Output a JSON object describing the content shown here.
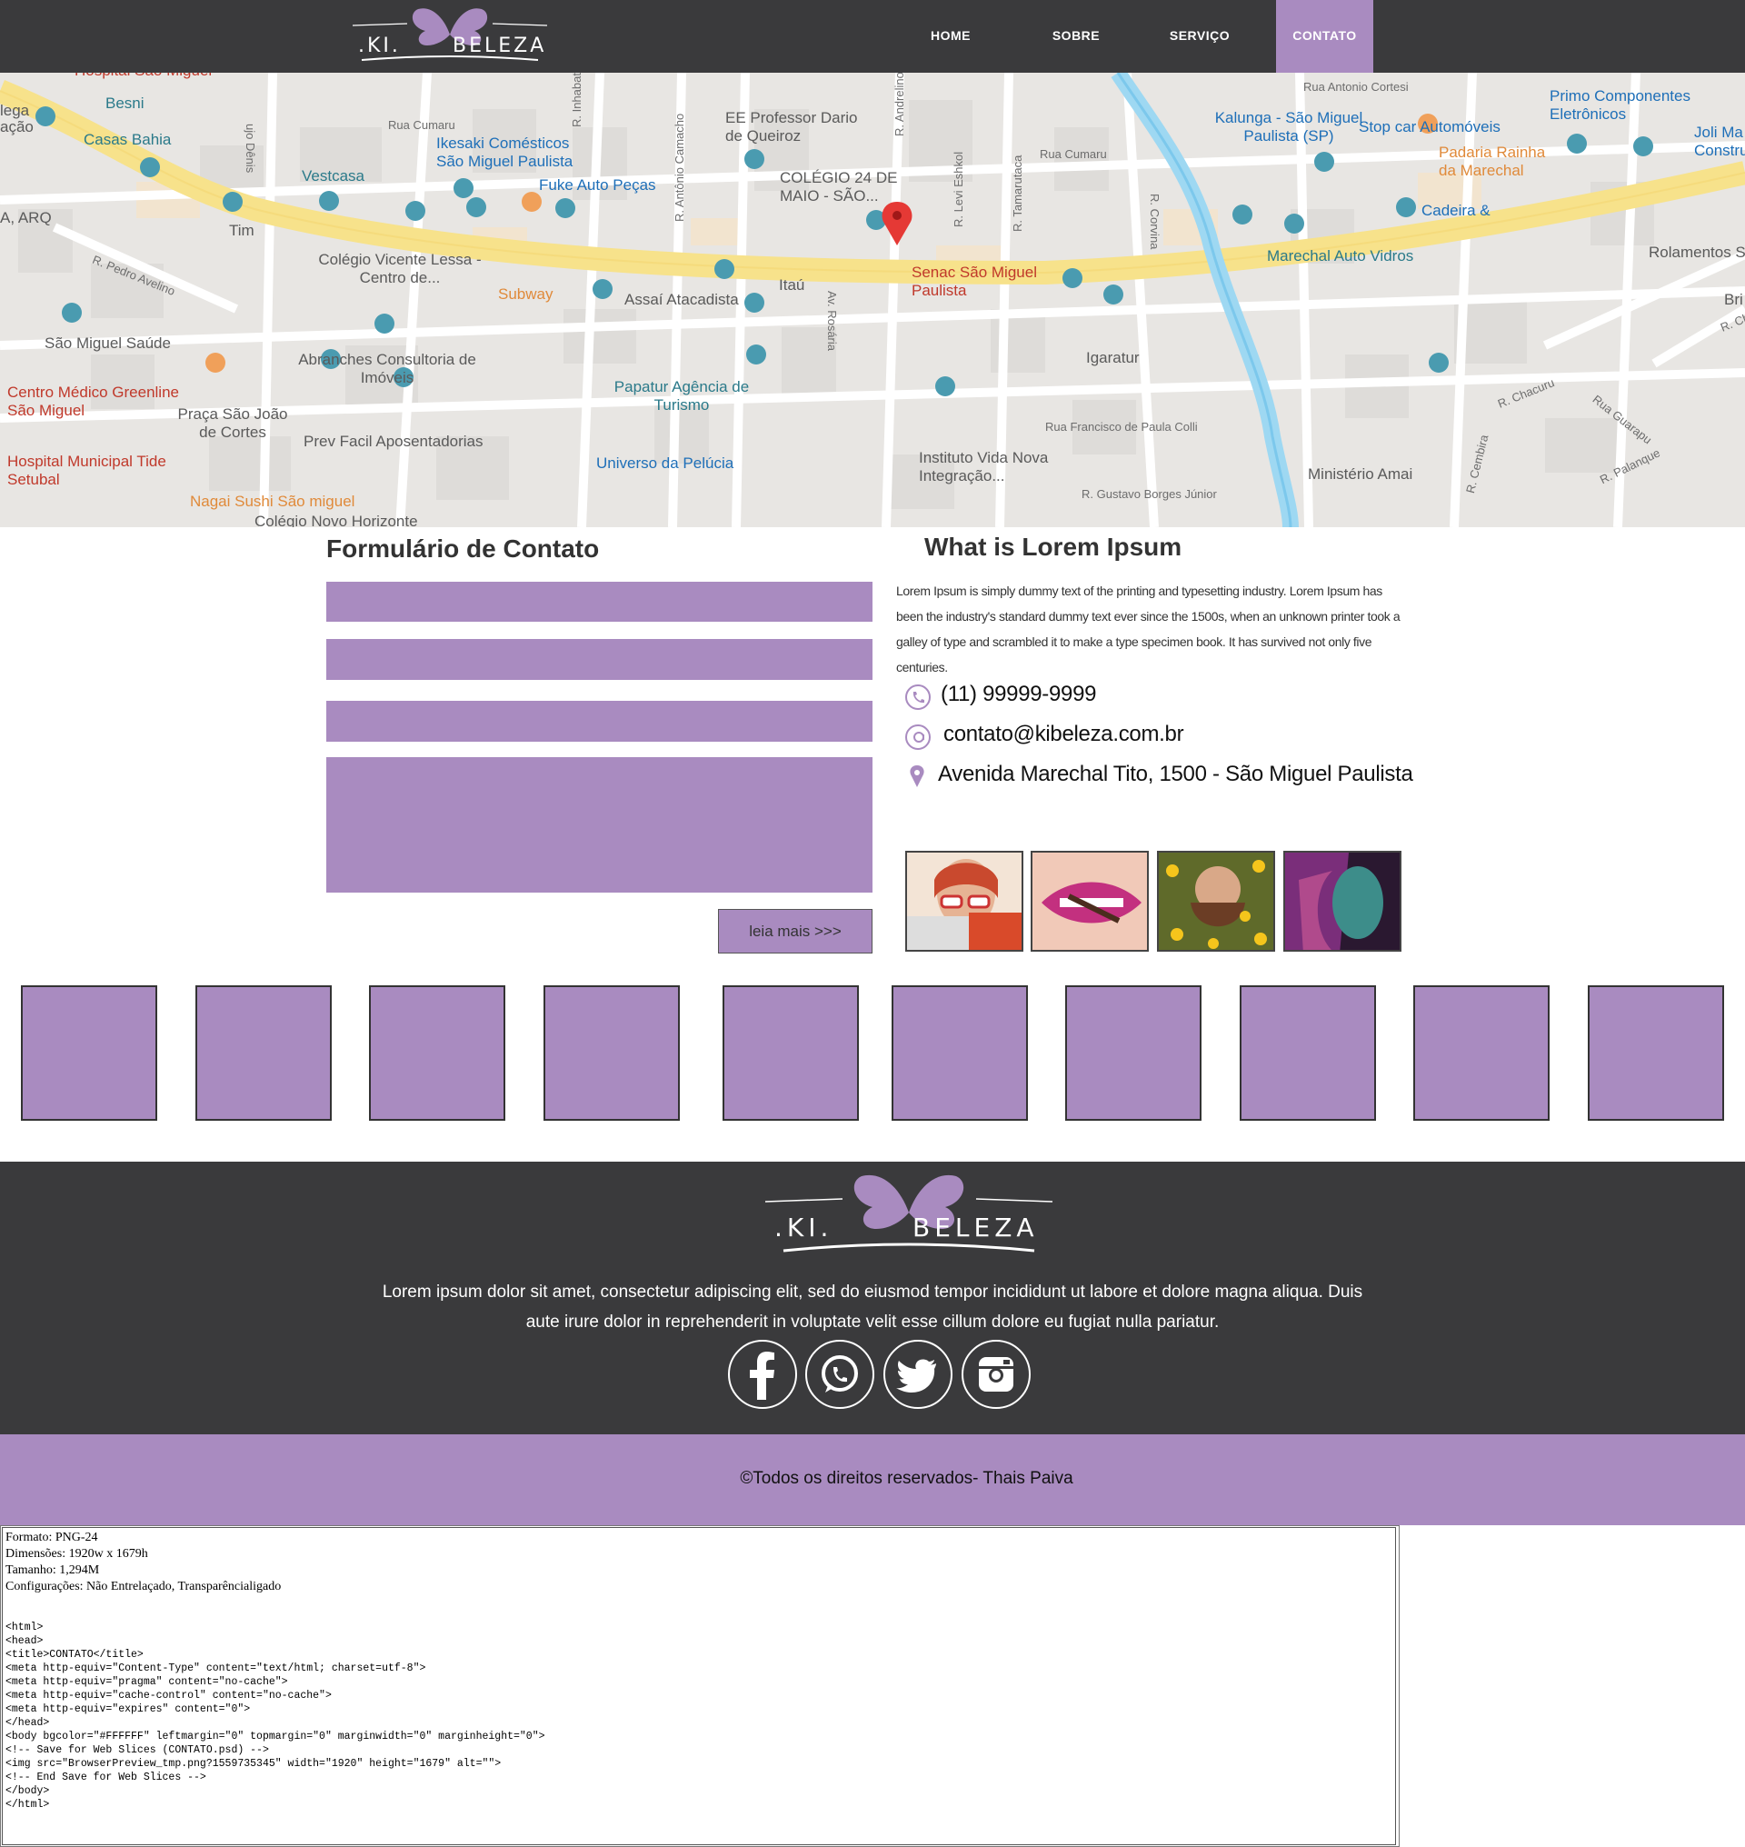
{
  "header": {
    "logo": {
      "left": ".KI.",
      "right": "BELEZA"
    },
    "nav": [
      {
        "label": "HOME"
      },
      {
        "label": "SOBRE"
      },
      {
        "label": "SERVIÇO"
      },
      {
        "label": "CONTATO",
        "active": true
      }
    ]
  },
  "map": {
    "pin_label": "Senac São Miguel Paulista",
    "labels": [
      "Hospital São Miguel",
      "Besni",
      "Casas Bahia",
      "Vestcasa",
      "Tim",
      "A, ARQ",
      "lega",
      "ação",
      "Ikesaki Comésticos São Miguel Paulista",
      "Fuke Auto Peças",
      "EE Professor Dario de Queiroz",
      "COLÉGIO 24 DE MAIO - SÃO...",
      "Colégio Vicente Lessa - Centro de...",
      "Subway",
      "Assaí Atacadista",
      "Itaú",
      "Senac São Miguel Paulista",
      "Kalunga - São Miguel Paulista (SP)",
      "Stop car Automóveis",
      "Padaria Rainha da Marechal",
      "Primo Componentes Eletrônicos",
      "Joli Ma Constru",
      "Cadeira &",
      "Marechal Auto Vidros",
      "Rolamentos S",
      "São Miguel Saúde",
      "Abranches Consultoria de Imóveis",
      "Centro Médico Greenline São Miguel",
      "Praça São João de Cortes",
      "Papatur Agência de Turismo",
      "Igaratur",
      "Prev Facil Aposentadorias",
      "Hospital Municipal Tide Setubal",
      "Universo da Pelúcia",
      "Instituto Vida Nova Integração...",
      "Ministério Amai",
      "Nagai Sushi São miguel",
      "Colégio Novo Horizonte",
      "Rua Cumaru",
      "Rua Antonio Cortesi",
      "R. Inhabata",
      "R. Antônio Camacho",
      "R. Levi Eshkol",
      "R. Tamarutaca",
      "R. Corvina",
      "Av. Rosária",
      "R. Pedro Avelino",
      "Rua Francisco de Paula Colli",
      "R. Chacuru",
      "Rua Guarapu",
      "R. Palanque",
      "R. Cembira",
      "R. Gustavo Borges Júnior",
      "R. Andrelino",
      "Bri",
      "R. Ch",
      "ujo Dênis",
      "Rua Cumaru"
    ]
  },
  "form": {
    "title": "Formulário de Contato",
    "fields": [
      "name",
      "email",
      "phone",
      "message"
    ],
    "submit_label": "leia mais >>>"
  },
  "info": {
    "title": "What is Lorem Ipsum",
    "text": "Lorem Ipsum is simply dummy text of the printing and typesetting industry. Lorem Ipsum has been the industry's standard dummy text ever since the 1500s, when an unknown printer took a galley of type and scrambled it to make a type specimen book. It has survived not only five centuries.",
    "phone": "(11) 99999-9999",
    "email": "contato@kibeleza.com.br",
    "address": "Avenida Marechal Tito, 1500 - São Miguel Paulista"
  },
  "footer": {
    "logo": {
      "left": ".KI.",
      "right": "BELEZA"
    },
    "text": "Lorem ipsum dolor sit amet, consectetur adipiscing elit, sed do eiusmod tempor incididunt ut labore et dolore magna aliqua. Duis aute irure dolor in reprehenderit in voluptate velit esse cillum dolore eu fugiat nulla pariatur.",
    "social": [
      "facebook-icon",
      "whatsapp-icon",
      "twitter-icon",
      "instagram-icon"
    ],
    "copyright": "©Todos os direitos reservados- Thais Paiva"
  },
  "panel": {
    "format": "Formato: PNG-24",
    "dimensions": "Dimensões: 1920w x 1679h",
    "size": "Tamanho: 1,294M",
    "settings": "Configurações: Não Entrelaçado, Transparêncialigado",
    "code": "<html>\n<head>\n<title>CONTATO</title>\n<meta http-equiv=\"Content-Type\" content=\"text/html; charset=utf-8\">\n<meta http-equiv=\"pragma\" content=\"no-cache\">\n<meta http-equiv=\"cache-control\" content=\"no-cache\">\n<meta http-equiv=\"expires\" content=\"0\">\n</head>\n<body bgcolor=\"#FFFFFF\" leftmargin=\"0\" topmargin=\"0\" marginwidth=\"0\" marginheight=\"0\">\n<!-- Save for Web Slices (CONTATO.psd) -->\n<img src=\"BrowserPreview_tmp.png?1559735345\" width=\"1920\" height=\"1679\" alt=\"\">\n<!-- End Save for Web Slices -->\n</body>\n</html>"
  },
  "colors": {
    "accent": "#a98bc0",
    "dark": "#3a3a3c"
  }
}
